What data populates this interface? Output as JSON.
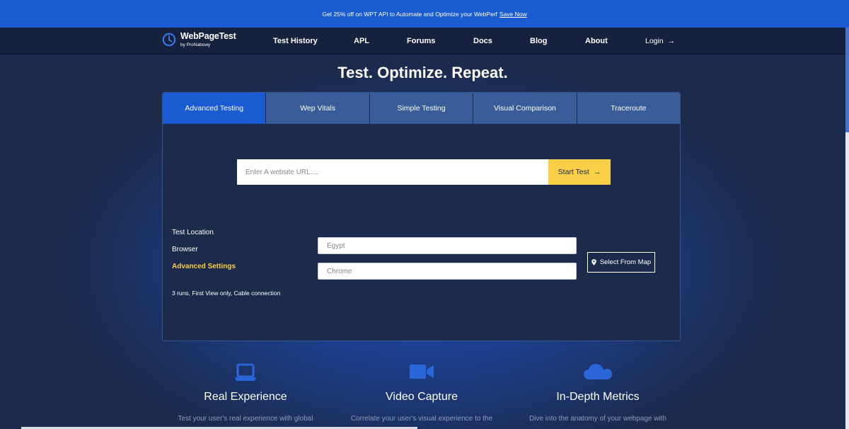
{
  "banner": {
    "text": "Get 25% off on WPT API to Automate and Optimize your WebPerf",
    "link": "Save Now"
  },
  "nav": {
    "logo_title": "WebPageTest",
    "logo_sub": "by ProNabowy",
    "items": [
      "Test History",
      "APL",
      "Forums",
      "Docs",
      "Blog",
      "About"
    ],
    "login": "Login"
  },
  "hero": {
    "title": "Test. Optimize. Repeat."
  },
  "tabs": [
    "Advanced Testing",
    "Wep Vitals",
    "Simple Testing",
    "Visual Comparison",
    "Traceroute"
  ],
  "active_tab": "Advanced Testing",
  "url": {
    "placeholder": "Enter A website URL....",
    "value": "",
    "button": "Start Test"
  },
  "settings": {
    "location_label": "Test Location",
    "browser_label": "Browser",
    "advanced_label": "Advanced Settings",
    "summary": "3 runs, First View only, Cable connection",
    "location_value": "Egypt",
    "browser_value": "Chrome",
    "map_button": "Select From Map"
  },
  "features": [
    {
      "icon": "laptop-icon",
      "title": "Real Experience",
      "desc": "Test your user's real experience with global"
    },
    {
      "icon": "video-camera-icon",
      "title": "Video Capture",
      "desc": "Correlate your user's visual experience to the"
    },
    {
      "icon": "cloud-icon",
      "title": "In-Depth Metrics",
      "desc": "Dive into the anatomy of your webpage with"
    }
  ],
  "colors": {
    "accent_blue": "#1a5bd1",
    "cta_yellow": "#f9cf47",
    "background": "#1c2a4b",
    "tab_inactive": "#3a5c98"
  }
}
